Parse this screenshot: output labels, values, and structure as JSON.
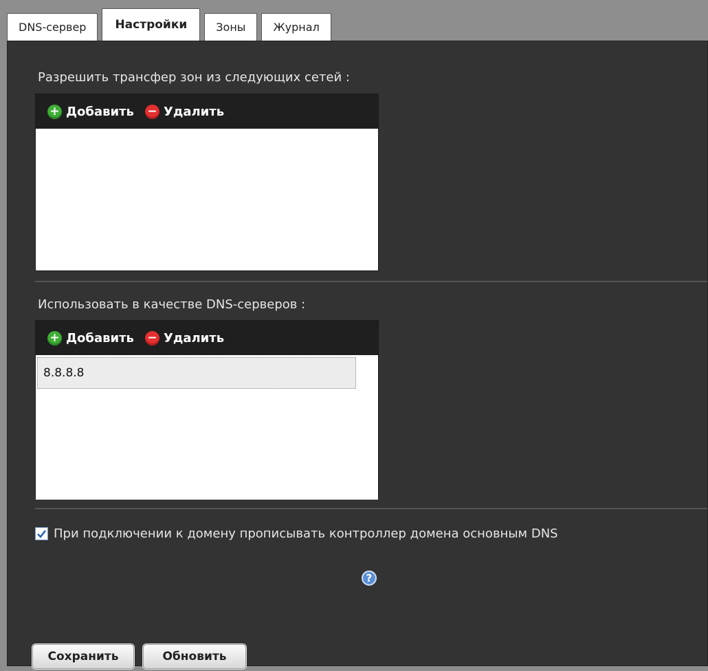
{
  "tabs": [
    {
      "label": "DNS-сервер"
    },
    {
      "label": "Настройки"
    },
    {
      "label": "Зоны"
    },
    {
      "label": "Журнал"
    }
  ],
  "transfer": {
    "label": "Разрешить трансфер зон из следующих сетей :",
    "add_label": "Добавить",
    "remove_label": "Удалить",
    "items": []
  },
  "dns_servers": {
    "label": "Использовать в качестве DNS-серверов :",
    "add_label": "Добавить",
    "remove_label": "Удалить",
    "items": [
      "8.8.8.8"
    ]
  },
  "domain_controller": {
    "label": "При подключении к домену прописывать контроллер домена основным DNS",
    "checked": true
  },
  "help_icon": "question-circle-icon",
  "buttons": {
    "save_label": "Сохранить",
    "refresh_label": "Обновить"
  }
}
